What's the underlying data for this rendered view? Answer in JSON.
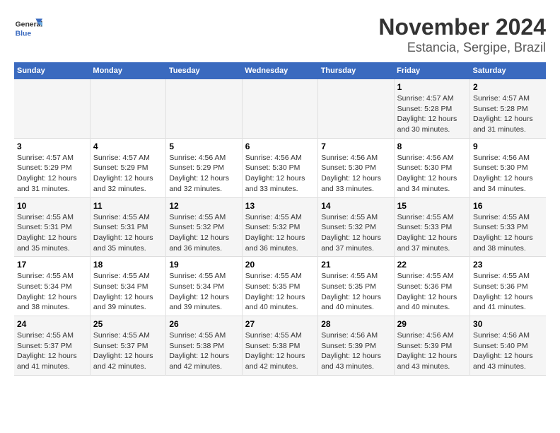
{
  "logo": {
    "general": "General",
    "blue": "Blue"
  },
  "title": "November 2024",
  "subtitle": "Estancia, Sergipe, Brazil",
  "days_header": [
    "Sunday",
    "Monday",
    "Tuesday",
    "Wednesday",
    "Thursday",
    "Friday",
    "Saturday"
  ],
  "weeks": [
    [
      {
        "day": "",
        "info": ""
      },
      {
        "day": "",
        "info": ""
      },
      {
        "day": "",
        "info": ""
      },
      {
        "day": "",
        "info": ""
      },
      {
        "day": "",
        "info": ""
      },
      {
        "day": "1",
        "info": "Sunrise: 4:57 AM\nSunset: 5:28 PM\nDaylight: 12 hours\nand 30 minutes."
      },
      {
        "day": "2",
        "info": "Sunrise: 4:57 AM\nSunset: 5:28 PM\nDaylight: 12 hours\nand 31 minutes."
      }
    ],
    [
      {
        "day": "3",
        "info": "Sunrise: 4:57 AM\nSunset: 5:29 PM\nDaylight: 12 hours\nand 31 minutes."
      },
      {
        "day": "4",
        "info": "Sunrise: 4:57 AM\nSunset: 5:29 PM\nDaylight: 12 hours\nand 32 minutes."
      },
      {
        "day": "5",
        "info": "Sunrise: 4:56 AM\nSunset: 5:29 PM\nDaylight: 12 hours\nand 32 minutes."
      },
      {
        "day": "6",
        "info": "Sunrise: 4:56 AM\nSunset: 5:30 PM\nDaylight: 12 hours\nand 33 minutes."
      },
      {
        "day": "7",
        "info": "Sunrise: 4:56 AM\nSunset: 5:30 PM\nDaylight: 12 hours\nand 33 minutes."
      },
      {
        "day": "8",
        "info": "Sunrise: 4:56 AM\nSunset: 5:30 PM\nDaylight: 12 hours\nand 34 minutes."
      },
      {
        "day": "9",
        "info": "Sunrise: 4:56 AM\nSunset: 5:30 PM\nDaylight: 12 hours\nand 34 minutes."
      }
    ],
    [
      {
        "day": "10",
        "info": "Sunrise: 4:55 AM\nSunset: 5:31 PM\nDaylight: 12 hours\nand 35 minutes."
      },
      {
        "day": "11",
        "info": "Sunrise: 4:55 AM\nSunset: 5:31 PM\nDaylight: 12 hours\nand 35 minutes."
      },
      {
        "day": "12",
        "info": "Sunrise: 4:55 AM\nSunset: 5:32 PM\nDaylight: 12 hours\nand 36 minutes."
      },
      {
        "day": "13",
        "info": "Sunrise: 4:55 AM\nSunset: 5:32 PM\nDaylight: 12 hours\nand 36 minutes."
      },
      {
        "day": "14",
        "info": "Sunrise: 4:55 AM\nSunset: 5:32 PM\nDaylight: 12 hours\nand 37 minutes."
      },
      {
        "day": "15",
        "info": "Sunrise: 4:55 AM\nSunset: 5:33 PM\nDaylight: 12 hours\nand 37 minutes."
      },
      {
        "day": "16",
        "info": "Sunrise: 4:55 AM\nSunset: 5:33 PM\nDaylight: 12 hours\nand 38 minutes."
      }
    ],
    [
      {
        "day": "17",
        "info": "Sunrise: 4:55 AM\nSunset: 5:34 PM\nDaylight: 12 hours\nand 38 minutes."
      },
      {
        "day": "18",
        "info": "Sunrise: 4:55 AM\nSunset: 5:34 PM\nDaylight: 12 hours\nand 39 minutes."
      },
      {
        "day": "19",
        "info": "Sunrise: 4:55 AM\nSunset: 5:34 PM\nDaylight: 12 hours\nand 39 minutes."
      },
      {
        "day": "20",
        "info": "Sunrise: 4:55 AM\nSunset: 5:35 PM\nDaylight: 12 hours\nand 40 minutes."
      },
      {
        "day": "21",
        "info": "Sunrise: 4:55 AM\nSunset: 5:35 PM\nDaylight: 12 hours\nand 40 minutes."
      },
      {
        "day": "22",
        "info": "Sunrise: 4:55 AM\nSunset: 5:36 PM\nDaylight: 12 hours\nand 40 minutes."
      },
      {
        "day": "23",
        "info": "Sunrise: 4:55 AM\nSunset: 5:36 PM\nDaylight: 12 hours\nand 41 minutes."
      }
    ],
    [
      {
        "day": "24",
        "info": "Sunrise: 4:55 AM\nSunset: 5:37 PM\nDaylight: 12 hours\nand 41 minutes."
      },
      {
        "day": "25",
        "info": "Sunrise: 4:55 AM\nSunset: 5:37 PM\nDaylight: 12 hours\nand 42 minutes."
      },
      {
        "day": "26",
        "info": "Sunrise: 4:55 AM\nSunset: 5:38 PM\nDaylight: 12 hours\nand 42 minutes."
      },
      {
        "day": "27",
        "info": "Sunrise: 4:55 AM\nSunset: 5:38 PM\nDaylight: 12 hours\nand 42 minutes."
      },
      {
        "day": "28",
        "info": "Sunrise: 4:56 AM\nSunset: 5:39 PM\nDaylight: 12 hours\nand 43 minutes."
      },
      {
        "day": "29",
        "info": "Sunrise: 4:56 AM\nSunset: 5:39 PM\nDaylight: 12 hours\nand 43 minutes."
      },
      {
        "day": "30",
        "info": "Sunrise: 4:56 AM\nSunset: 5:40 PM\nDaylight: 12 hours\nand 43 minutes."
      }
    ]
  ]
}
